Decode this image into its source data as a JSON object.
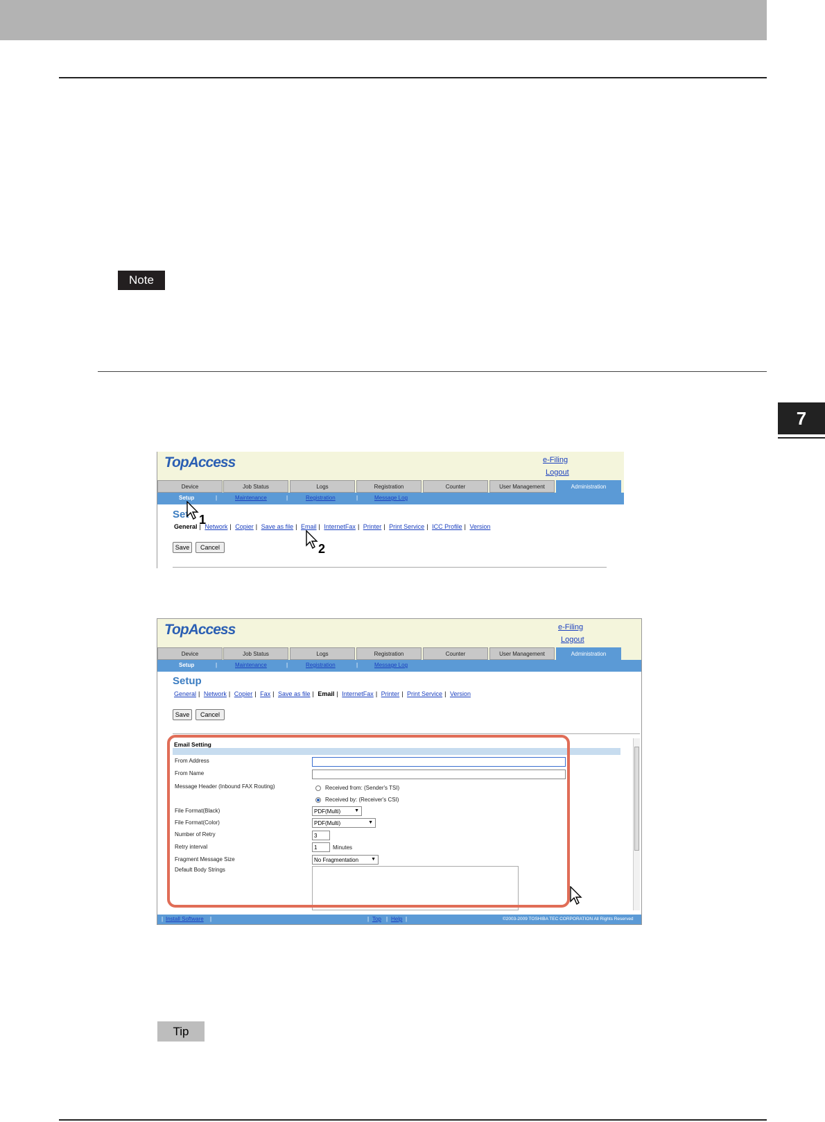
{
  "chapter": {
    "number": "7"
  },
  "badges": {
    "note": "Note",
    "tip": "Tip"
  },
  "topaccess": {
    "logo": "TopAccess",
    "efiling": "e-Filing",
    "logout": "Logout",
    "tabs": [
      "Device",
      "Job Status",
      "Logs",
      "Registration",
      "Counter",
      "User Management",
      "Administration"
    ],
    "subnav": {
      "setup": "Setup",
      "maintenance": "Maintenance",
      "registration": "Registration",
      "message_log": "Message Log",
      "sep": "|"
    },
    "page_title": "Setup",
    "save": "Save",
    "cancel": "Cancel"
  },
  "shot1": {
    "title_partial": "Set",
    "current": "General",
    "links": [
      "Network",
      "Copier",
      "Save as file",
      "Email",
      "InternetFax",
      "Printer",
      "Print Service",
      "ICC Profile",
      "Version"
    ],
    "callouts": [
      "1",
      "2"
    ]
  },
  "shot2": {
    "links_before": [
      "General",
      "Network",
      "Copier",
      "Fax",
      "Save as file"
    ],
    "current": "Email",
    "links_after": [
      "InternetFax",
      "Printer",
      "Print Service",
      "Version"
    ],
    "section_title": "Email Setting",
    "rows": {
      "from_address": "From Address",
      "from_name": "From Name",
      "message_header": "Message Header (Inbound FAX Routing)",
      "radio1": "Received from: (Sender's TSI)",
      "radio2": "Received by: (Receiver's CSI)",
      "file_format_black": "File Format(Black)",
      "file_format_black_val": "PDF(Multi)",
      "file_format_color": "File Format(Color)",
      "file_format_color_val": "PDF(Multi)",
      "retry_number": "Number of Retry",
      "retry_number_val": "3",
      "retry_interval": "Retry interval",
      "retry_interval_val": "1",
      "minutes": "Minutes",
      "fragment": "Fragment Message Size",
      "fragment_val": "No Fragmentation",
      "default_body": "Default Body Strings"
    },
    "footer": {
      "install": "Install Software",
      "top": "Top",
      "help": "Help",
      "copyright": "©2003-2009 TOSHIBA TEC CORPORATION All Rights Reserved"
    }
  }
}
